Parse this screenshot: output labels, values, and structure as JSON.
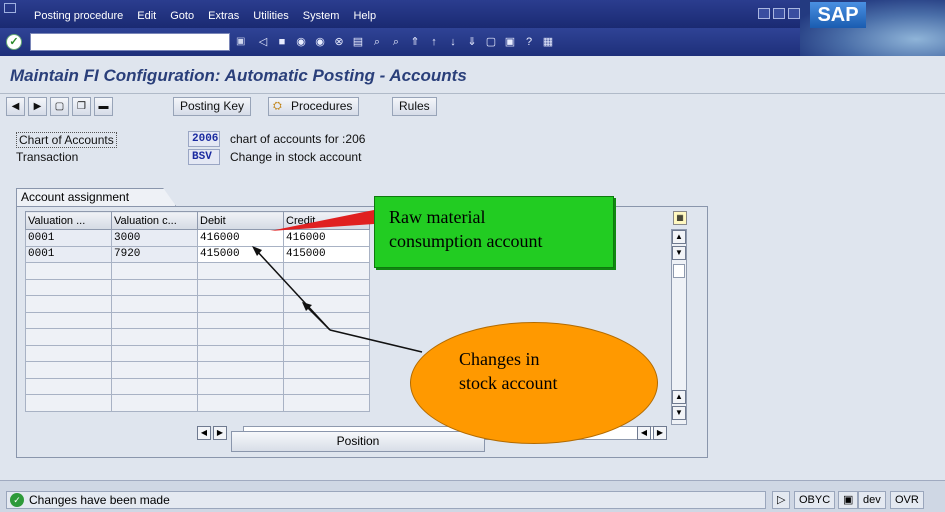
{
  "menu": {
    "items": [
      "Posting procedure",
      "Edit",
      "Goto",
      "Extras",
      "Utilities",
      "System",
      "Help"
    ]
  },
  "brand": {
    "logo": "SAP"
  },
  "title": "Maintain FI Configuration: Automatic Posting - Accounts",
  "toolbar": {
    "posting_key": "Posting Key",
    "procedures": "Procedures",
    "rules": "Rules"
  },
  "header": {
    "chart_label": "Chart of Accounts",
    "chart_value": "2006",
    "chart_desc": "chart of accounts for :206",
    "trans_label": "Transaction",
    "trans_value": "BSV",
    "trans_desc": "Change in stock account"
  },
  "group_title": "Account assignment",
  "table": {
    "headers": [
      "Valuation ...",
      "Valuation c...",
      "Debit",
      "Credit"
    ],
    "rows": [
      [
        "0001",
        "3000",
        "416000",
        "416000"
      ],
      [
        "0001",
        "7920",
        "415000",
        "415000"
      ]
    ]
  },
  "position_button": "Position",
  "status": {
    "message": "Changes have been made",
    "transaction": "OBYC",
    "system": "dev",
    "mode": "OVR"
  },
  "annotations": {
    "green_line1": "Raw material",
    "green_line2": "consumption account",
    "orange_line1": "Changes in",
    "orange_line2": "stock account"
  },
  "colors": {
    "menubar": "#1a2a72",
    "title_text": "#2a3f7a",
    "callout_green": "#22cc22",
    "callout_orange": "#ff9900"
  }
}
